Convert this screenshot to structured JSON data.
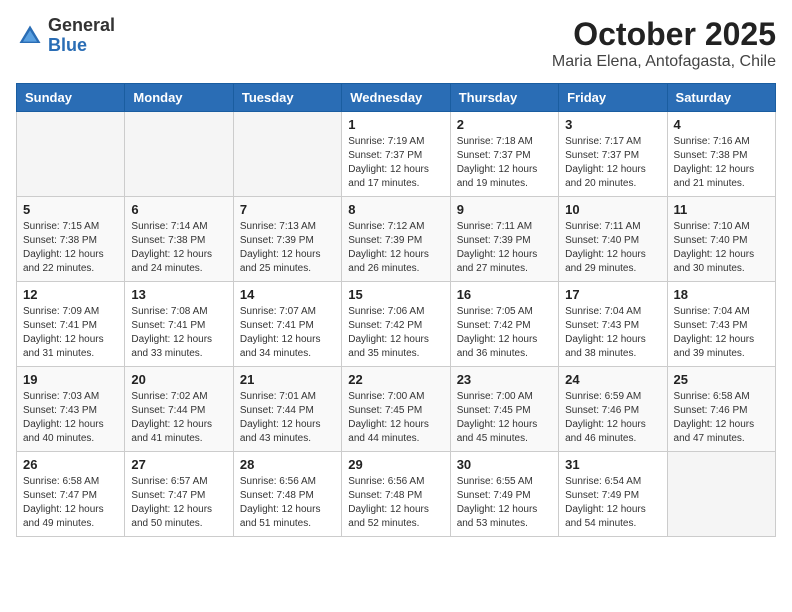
{
  "header": {
    "logo_general": "General",
    "logo_blue": "Blue",
    "month": "October 2025",
    "location": "Maria Elena, Antofagasta, Chile"
  },
  "days_of_week": [
    "Sunday",
    "Monday",
    "Tuesday",
    "Wednesday",
    "Thursday",
    "Friday",
    "Saturday"
  ],
  "weeks": [
    [
      {
        "day": "",
        "info": ""
      },
      {
        "day": "",
        "info": ""
      },
      {
        "day": "",
        "info": ""
      },
      {
        "day": "1",
        "info": "Sunrise: 7:19 AM\nSunset: 7:37 PM\nDaylight: 12 hours and 17 minutes."
      },
      {
        "day": "2",
        "info": "Sunrise: 7:18 AM\nSunset: 7:37 PM\nDaylight: 12 hours and 19 minutes."
      },
      {
        "day": "3",
        "info": "Sunrise: 7:17 AM\nSunset: 7:37 PM\nDaylight: 12 hours and 20 minutes."
      },
      {
        "day": "4",
        "info": "Sunrise: 7:16 AM\nSunset: 7:38 PM\nDaylight: 12 hours and 21 minutes."
      }
    ],
    [
      {
        "day": "5",
        "info": "Sunrise: 7:15 AM\nSunset: 7:38 PM\nDaylight: 12 hours and 22 minutes."
      },
      {
        "day": "6",
        "info": "Sunrise: 7:14 AM\nSunset: 7:38 PM\nDaylight: 12 hours and 24 minutes."
      },
      {
        "day": "7",
        "info": "Sunrise: 7:13 AM\nSunset: 7:39 PM\nDaylight: 12 hours and 25 minutes."
      },
      {
        "day": "8",
        "info": "Sunrise: 7:12 AM\nSunset: 7:39 PM\nDaylight: 12 hours and 26 minutes."
      },
      {
        "day": "9",
        "info": "Sunrise: 7:11 AM\nSunset: 7:39 PM\nDaylight: 12 hours and 27 minutes."
      },
      {
        "day": "10",
        "info": "Sunrise: 7:11 AM\nSunset: 7:40 PM\nDaylight: 12 hours and 29 minutes."
      },
      {
        "day": "11",
        "info": "Sunrise: 7:10 AM\nSunset: 7:40 PM\nDaylight: 12 hours and 30 minutes."
      }
    ],
    [
      {
        "day": "12",
        "info": "Sunrise: 7:09 AM\nSunset: 7:41 PM\nDaylight: 12 hours and 31 minutes."
      },
      {
        "day": "13",
        "info": "Sunrise: 7:08 AM\nSunset: 7:41 PM\nDaylight: 12 hours and 33 minutes."
      },
      {
        "day": "14",
        "info": "Sunrise: 7:07 AM\nSunset: 7:41 PM\nDaylight: 12 hours and 34 minutes."
      },
      {
        "day": "15",
        "info": "Sunrise: 7:06 AM\nSunset: 7:42 PM\nDaylight: 12 hours and 35 minutes."
      },
      {
        "day": "16",
        "info": "Sunrise: 7:05 AM\nSunset: 7:42 PM\nDaylight: 12 hours and 36 minutes."
      },
      {
        "day": "17",
        "info": "Sunrise: 7:04 AM\nSunset: 7:43 PM\nDaylight: 12 hours and 38 minutes."
      },
      {
        "day": "18",
        "info": "Sunrise: 7:04 AM\nSunset: 7:43 PM\nDaylight: 12 hours and 39 minutes."
      }
    ],
    [
      {
        "day": "19",
        "info": "Sunrise: 7:03 AM\nSunset: 7:43 PM\nDaylight: 12 hours and 40 minutes."
      },
      {
        "day": "20",
        "info": "Sunrise: 7:02 AM\nSunset: 7:44 PM\nDaylight: 12 hours and 41 minutes."
      },
      {
        "day": "21",
        "info": "Sunrise: 7:01 AM\nSunset: 7:44 PM\nDaylight: 12 hours and 43 minutes."
      },
      {
        "day": "22",
        "info": "Sunrise: 7:00 AM\nSunset: 7:45 PM\nDaylight: 12 hours and 44 minutes."
      },
      {
        "day": "23",
        "info": "Sunrise: 7:00 AM\nSunset: 7:45 PM\nDaylight: 12 hours and 45 minutes."
      },
      {
        "day": "24",
        "info": "Sunrise: 6:59 AM\nSunset: 7:46 PM\nDaylight: 12 hours and 46 minutes."
      },
      {
        "day": "25",
        "info": "Sunrise: 6:58 AM\nSunset: 7:46 PM\nDaylight: 12 hours and 47 minutes."
      }
    ],
    [
      {
        "day": "26",
        "info": "Sunrise: 6:58 AM\nSunset: 7:47 PM\nDaylight: 12 hours and 49 minutes."
      },
      {
        "day": "27",
        "info": "Sunrise: 6:57 AM\nSunset: 7:47 PM\nDaylight: 12 hours and 50 minutes."
      },
      {
        "day": "28",
        "info": "Sunrise: 6:56 AM\nSunset: 7:48 PM\nDaylight: 12 hours and 51 minutes."
      },
      {
        "day": "29",
        "info": "Sunrise: 6:56 AM\nSunset: 7:48 PM\nDaylight: 12 hours and 52 minutes."
      },
      {
        "day": "30",
        "info": "Sunrise: 6:55 AM\nSunset: 7:49 PM\nDaylight: 12 hours and 53 minutes."
      },
      {
        "day": "31",
        "info": "Sunrise: 6:54 AM\nSunset: 7:49 PM\nDaylight: 12 hours and 54 minutes."
      },
      {
        "day": "",
        "info": ""
      }
    ]
  ]
}
